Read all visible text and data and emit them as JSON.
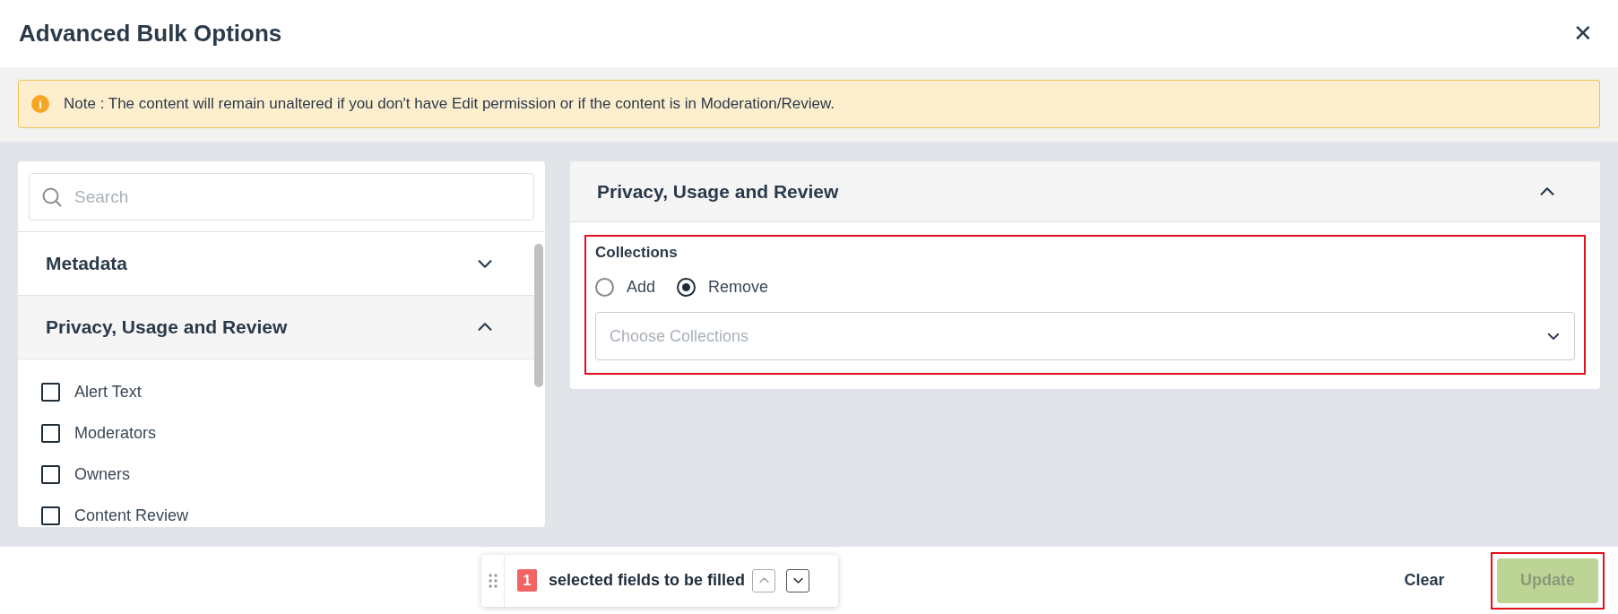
{
  "dialog": {
    "title": "Advanced Bulk Options",
    "close_label": "✕"
  },
  "note": {
    "icon": "i",
    "text": "Note : The content will remain unaltered if you don't have Edit permission or if the content is in Moderation/Review."
  },
  "left_panel": {
    "search": {
      "placeholder": "Search"
    },
    "sections": [
      {
        "title": "Metadata",
        "expanded": false
      },
      {
        "title": "Privacy, Usage and Review",
        "expanded": true,
        "items": [
          {
            "label": "Alert Text",
            "checked": false
          },
          {
            "label": "Moderators",
            "checked": false
          },
          {
            "label": "Owners",
            "checked": false
          },
          {
            "label": "Content Review",
            "checked": false
          }
        ]
      }
    ]
  },
  "right_panel": {
    "title": "Privacy, Usage and Review",
    "expanded": true,
    "fields": [
      {
        "label": "Collections",
        "highlighted": true,
        "options": [
          {
            "label": "Add",
            "selected": false
          },
          {
            "label": "Remove",
            "selected": true
          }
        ],
        "dropdown": {
          "placeholder": "Choose Collections"
        }
      }
    ]
  },
  "footer": {
    "count": "1",
    "count_text": "selected fields to be filled",
    "prev_disabled": true,
    "next_disabled": false,
    "buttons": [
      {
        "label": "Clear",
        "kind": "text"
      },
      {
        "label": "Update",
        "kind": "primary",
        "disabled": true,
        "highlighted": true
      }
    ]
  }
}
